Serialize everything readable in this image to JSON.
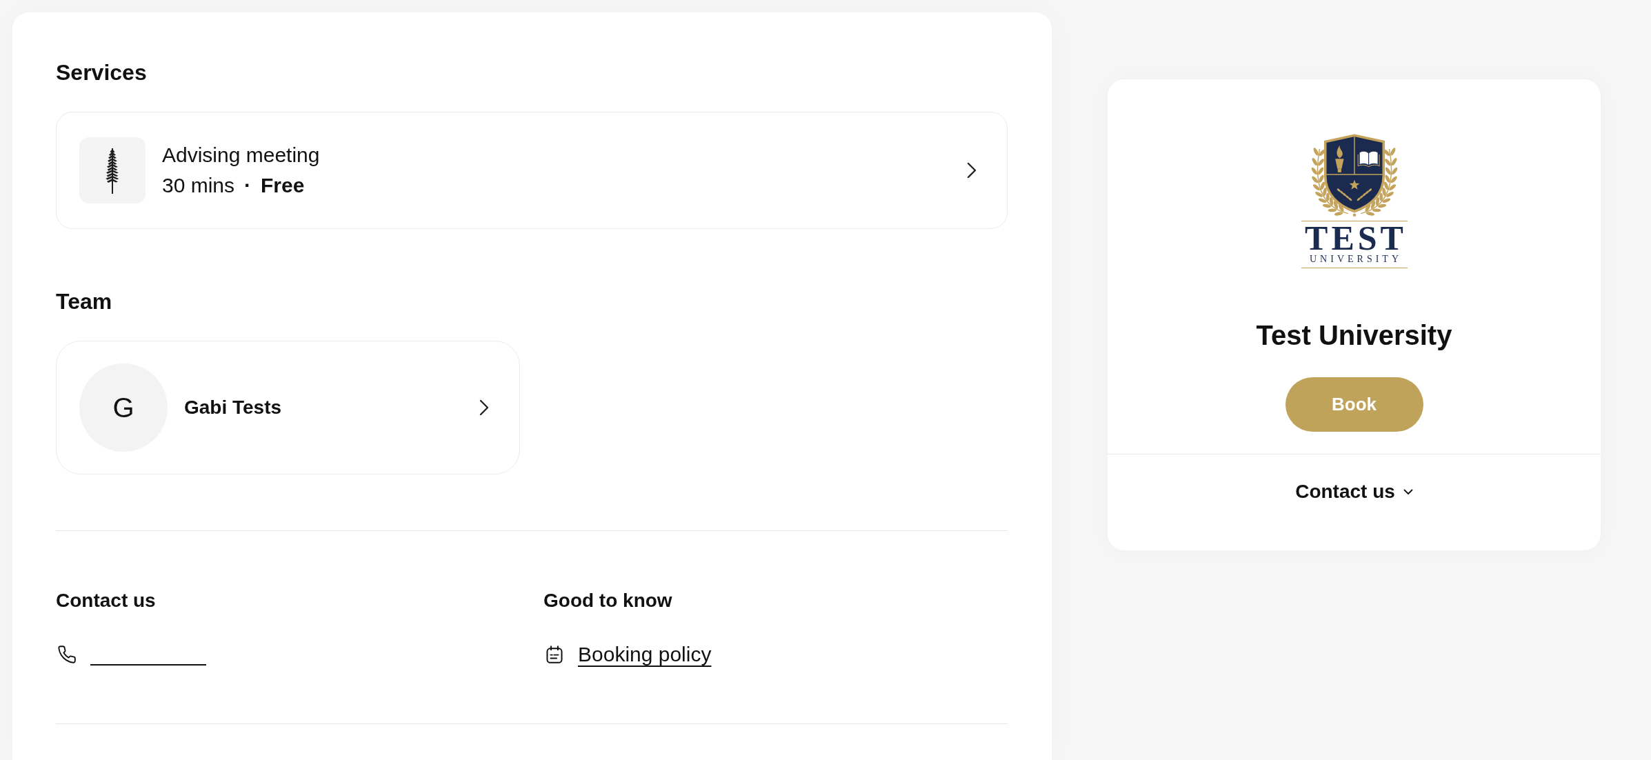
{
  "services": {
    "heading": "Services",
    "items": [
      {
        "title": "Advising meeting",
        "duration": "30 mins",
        "separator": "·",
        "price": "Free"
      }
    ]
  },
  "team": {
    "heading": "Team",
    "members": [
      {
        "initial": "G",
        "name": "Gabi Tests"
      }
    ]
  },
  "info": [
    {
      "heading": "Contact us",
      "links": [
        {
          "kind": "phone"
        }
      ]
    },
    {
      "heading": "Good to know",
      "links": [
        {
          "kind": "policy",
          "label": "Booking policy"
        }
      ]
    }
  ],
  "profile": {
    "logo": {
      "wordmark": "TEST",
      "subtitle": "UNIVERSITY"
    },
    "name": "Test University",
    "book_button": "Book",
    "contact_toggle": {
      "label": "Contact us",
      "expanded": false
    }
  }
}
